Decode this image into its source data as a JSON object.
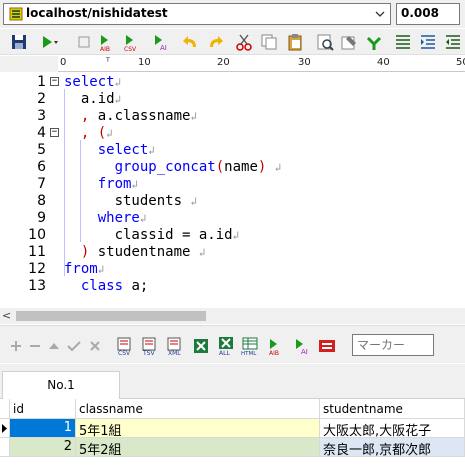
{
  "connection": {
    "name": "localhost/nishidatest",
    "exec_time": "0.008"
  },
  "ruler": {
    "labels": [
      "0",
      "10",
      "20",
      "30",
      "40",
      "50"
    ]
  },
  "editor": {
    "lines": [
      {
        "num": "1",
        "fold": "−"
      },
      {
        "num": "2"
      },
      {
        "num": "3"
      },
      {
        "num": "4",
        "fold": "−"
      },
      {
        "num": "5"
      },
      {
        "num": "6"
      },
      {
        "num": "7"
      },
      {
        "num": "8"
      },
      {
        "num": "9"
      },
      {
        "num": "10"
      },
      {
        "num": "11"
      },
      {
        "num": "12"
      },
      {
        "num": "13"
      }
    ],
    "code": {
      "l1_kw": "select",
      "l2_text": "a.id",
      "l3_comma": ",",
      "l3_text": "a.classname",
      "l4_comma": ",",
      "l4_paren": "(",
      "l5_kw": "select",
      "l6_fn": "group_concat",
      "l6_open": "(",
      "l6_arg": "name",
      "l6_close": ")",
      "l7_kw": "from",
      "l8_text": "students",
      "l9_kw": "where",
      "l10_text": "classid = a.id",
      "l11_paren": ")",
      "l11_text": "studentname",
      "l12_kw": "from",
      "l13_kw": "class",
      "l13_text": "a;"
    },
    "return_mark": "↲"
  },
  "result_toolbar": {
    "marker_placeholder": "マーカー"
  },
  "tabs": [
    {
      "label": "No.1"
    }
  ],
  "grid": {
    "columns": [
      "id",
      "classname",
      "studentname"
    ],
    "rows": [
      {
        "id": "1",
        "classname": "5年1組",
        "studentname": "大阪太郎,大阪花子"
      },
      {
        "id": "2",
        "classname": "5年2組",
        "studentname": "奈良一郎,京都次郎"
      }
    ]
  },
  "colors": {
    "keyword": "#0000ff",
    "bracket": "#c00000",
    "selected_id_cell": "#0078d7",
    "row1_bg": "#ffffcc",
    "row2_bg": "#d9e8c8",
    "row2_sn_bg": "#dce6f4"
  }
}
